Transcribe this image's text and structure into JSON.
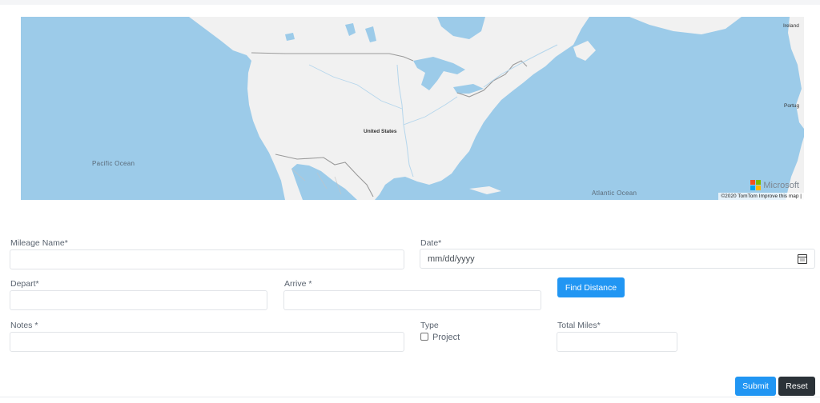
{
  "map": {
    "labels": {
      "united_states": "United States",
      "pacific_ocean": "Pacific Ocean",
      "atlantic_ocean": "Atlantic Ocean",
      "ireland": "Ireland",
      "portugal": "Portug"
    },
    "logo_text": "Microsoft",
    "attribution": "©2020 TomTom  Improve this map |",
    "colors": {
      "water": "#9ccbe9",
      "land": "#f1f1f1",
      "border": "#9a9a9a"
    }
  },
  "form": {
    "mileage_name": {
      "label": "Mileage Name*",
      "value": ""
    },
    "date": {
      "label": "Date*",
      "placeholder": "mm/dd/yyyy",
      "icon": "calendar-icon"
    },
    "depart": {
      "label": "Depart*",
      "value": ""
    },
    "arrive": {
      "label": "Arrive *",
      "value": ""
    },
    "find_distance_label": "Find Distance",
    "notes": {
      "label": "Notes *",
      "value": ""
    },
    "type": {
      "label": "Type",
      "option_label": "Project",
      "checked": false
    },
    "total_miles": {
      "label": "Total Miles*",
      "value": ""
    }
  },
  "actions": {
    "submit_label": "Submit",
    "reset_label": "Reset",
    "primary_color": "#2196f3",
    "dark_color": "#2b3238"
  }
}
